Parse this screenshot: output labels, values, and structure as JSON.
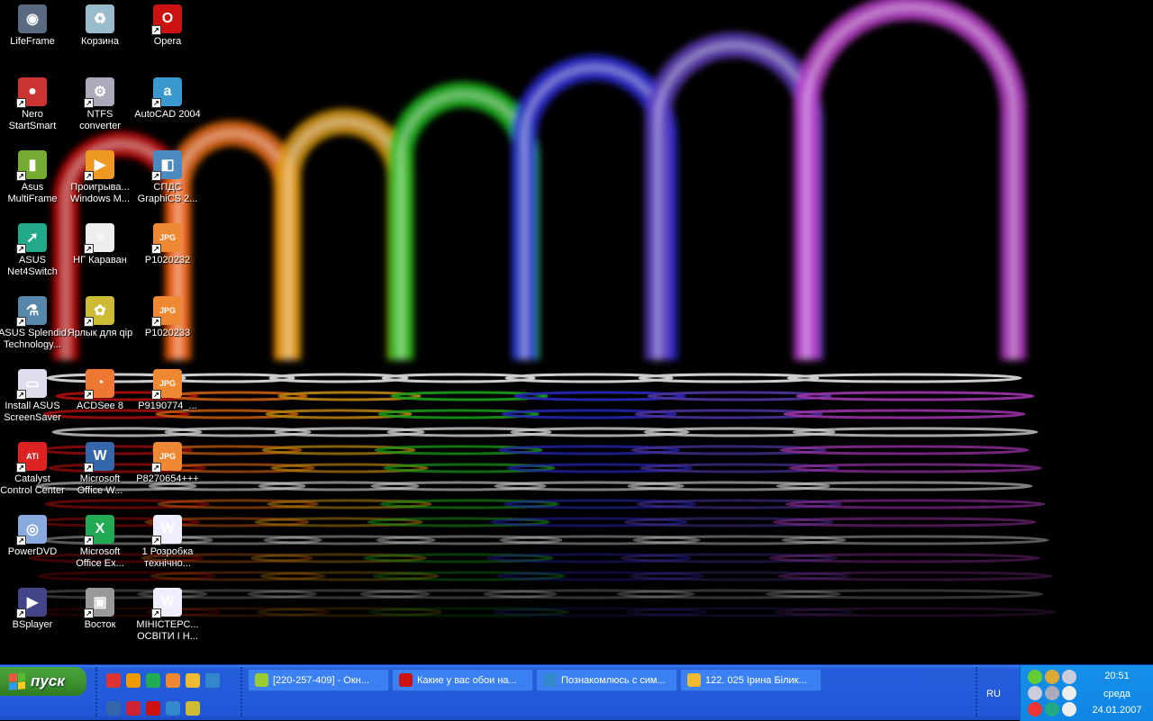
{
  "desktop": {
    "icons": [
      {
        "label": "LifeFrame",
        "color": "#5a6a80",
        "glyph": "◉"
      },
      {
        "label": "Nero\nStartSmart",
        "color": "#c33",
        "glyph": "●"
      },
      {
        "label": "Asus\nMultiFrame",
        "color": "#7a3",
        "glyph": "▮"
      },
      {
        "label": "ASUS\nNet4Switch",
        "color": "#2a8",
        "glyph": "➚"
      },
      {
        "label": "ASUS Splendid\nTechnology...",
        "color": "#58a",
        "glyph": "⚗"
      },
      {
        "label": "Install ASUS\nScreenSaver",
        "color": "#dde",
        "glyph": "▭"
      },
      {
        "label": "Catalyst\nControl Center",
        "color": "#d22",
        "glyph": "ATi"
      },
      {
        "label": "PowerDVD",
        "color": "#8ad",
        "glyph": "◎"
      },
      {
        "label": "BSplayer",
        "color": "#448",
        "glyph": "▶"
      },
      {
        "label": "Корзина",
        "color": "#9bc",
        "glyph": "♻"
      },
      {
        "label": "NTFS\nconverter",
        "color": "#aab",
        "glyph": "⚙"
      },
      {
        "label": "Проигрыва...\nWindows M...",
        "color": "#e92",
        "glyph": "▶"
      },
      {
        "label": "НГ Караван",
        "color": "#eee",
        "glyph": "≡"
      },
      {
        "label": "Ярлык для qip",
        "color": "#cb3",
        "glyph": "✿"
      },
      {
        "label": "ACDSee 8",
        "color": "#e73",
        "glyph": "◔"
      },
      {
        "label": "Microsoft\nOffice W...",
        "color": "#36a",
        "glyph": "W"
      },
      {
        "label": "Microsoft\nOffice Ex...",
        "color": "#2a5",
        "glyph": "X"
      },
      {
        "label": "Восток",
        "color": "#999",
        "glyph": "▣"
      },
      {
        "label": "Opera",
        "color": "#c11",
        "glyph": "O"
      },
      {
        "label": "AutoCAD 2004",
        "color": "#3a9ad0",
        "glyph": "a"
      },
      {
        "label": "СПДС\nGraphiCS 2...",
        "color": "#4a8ac0",
        "glyph": "◧"
      },
      {
        "label": "P1020232",
        "color": "#e83",
        "glyph": "JPG"
      },
      {
        "label": "P1020233",
        "color": "#e83",
        "glyph": "JPG"
      },
      {
        "label": "P9190774_...",
        "color": "#e83",
        "glyph": "JPG"
      },
      {
        "label": "P8270654+++",
        "color": "#e83",
        "glyph": "JPG"
      },
      {
        "label": "1 Розробка\nтехнічно...",
        "color": "#eef",
        "glyph": "W"
      },
      {
        "label": "МІНІСТЕРС...\nОСВІТИ І Н...",
        "color": "#eef",
        "glyph": "W"
      }
    ]
  },
  "taskbar": {
    "start_label": "пуск",
    "quicklaunch_row1": [
      "#d33",
      "#e90",
      "#2a5",
      "#e83",
      "#eb3",
      "#38c"
    ],
    "quicklaunch_row2": [
      "#36a",
      "#c23",
      "#c11",
      "#38c",
      "#cb3"
    ],
    "windows": [
      {
        "label": "[220-257-409] - Окн...",
        "color": "#9c3"
      },
      {
        "label": "Какие у вас обои на...",
        "color": "#c11"
      },
      {
        "label": "Познакомлюсь с сим...",
        "color": "#38c"
      },
      {
        "label": "122. 025 Ірина Білик...",
        "color": "#eb3"
      }
    ],
    "language": "RU"
  },
  "tray": {
    "time": "20:51",
    "day": "среда",
    "date": "24.01.2007",
    "icons": [
      "#6c3",
      "#da3",
      "#ccd",
      "#ccd",
      "#aab",
      "#eee",
      "#e33",
      "#2a8",
      "#eee"
    ]
  }
}
